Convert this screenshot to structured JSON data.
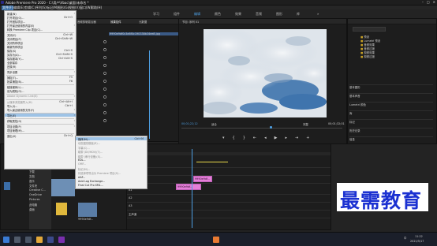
{
  "window": {
    "title": "Adobe Premiere Pro 2020 - C:\\用户\\Vbac\\桌面\\未命名 *",
    "minimize": "–",
    "maximize": "□",
    "close": "✕"
  },
  "menubar": [
    "文件(F)",
    "编辑(E)",
    "剪辑(C)",
    "序列(S)",
    "标记(M)",
    "图形(G)",
    "视图(V)",
    "窗口(W)",
    "帮助(H)"
  ],
  "workspace_tabs": [
    "学习",
    "组件",
    "编辑",
    "颜色",
    "效果",
    "音频",
    "图形",
    "库",
    "»"
  ],
  "file_menu": {
    "items": [
      {
        "label": "新建(N)",
        "shortcut": "",
        "arrow": true,
        "disabled": false
      },
      {
        "label": "打开项目(O)...",
        "shortcut": "Ctrl+O",
        "arrow": false,
        "disabled": false
      },
      {
        "label": "打开团队项目...",
        "shortcut": "",
        "arrow": false,
        "disabled": false
      },
      {
        "label": "打开最近使用的内容(E)",
        "shortcut": "",
        "arrow": true,
        "disabled": false
      },
      {
        "label": "转换 Premiere Clip 项目(C)...",
        "shortcut": "",
        "arrow": false,
        "disabled": false
      },
      {
        "sep": true
      },
      {
        "label": "关闭(C)",
        "shortcut": "Ctrl+W",
        "arrow": false,
        "disabled": false
      },
      {
        "label": "关闭项目(P)",
        "shortcut": "Ctrl+Shift+W",
        "arrow": false,
        "disabled": false
      },
      {
        "label": "关闭所有项目",
        "shortcut": "",
        "arrow": false,
        "disabled": false
      },
      {
        "label": "刷新所有项目",
        "shortcut": "",
        "arrow": false,
        "disabled": false
      },
      {
        "label": "保存(S)",
        "shortcut": "Ctrl+S",
        "arrow": false,
        "disabled": false
      },
      {
        "label": "另存为(A)...",
        "shortcut": "Ctrl+Shift+S",
        "arrow": false,
        "disabled": false
      },
      {
        "label": "保存副本(Y)...",
        "shortcut": "Ctrl+Alt+S",
        "arrow": false,
        "disabled": false
      },
      {
        "label": "全部保存",
        "shortcut": "",
        "arrow": false,
        "disabled": false
      },
      {
        "label": "还原(R)",
        "shortcut": "",
        "arrow": false,
        "disabled": false
      },
      {
        "sep": true
      },
      {
        "label": "同步设置",
        "shortcut": "",
        "arrow": true,
        "disabled": false
      },
      {
        "sep": true
      },
      {
        "label": "捕捉(T)...",
        "shortcut": "F5",
        "arrow": false,
        "disabled": false
      },
      {
        "label": "批量捕捉(B)...",
        "shortcut": "F6",
        "arrow": false,
        "disabled": false
      },
      {
        "sep": true
      },
      {
        "label": "链接媒体(L)...",
        "shortcut": "",
        "arrow": false,
        "disabled": false
      },
      {
        "label": "设为脱机(O)...",
        "shortcut": "",
        "arrow": false,
        "disabled": false
      },
      {
        "sep": true
      },
      {
        "label": "Adobe Dynamic Link(K)",
        "shortcut": "",
        "arrow": true,
        "disabled": true
      },
      {
        "sep": true
      },
      {
        "label": "从媒体浏览器导入(M)",
        "shortcut": "Ctrl+Alt+I",
        "arrow": false,
        "disabled": true
      },
      {
        "label": "导入(I)...",
        "shortcut": "Ctrl+I",
        "arrow": false,
        "disabled": false
      },
      {
        "label": "导入最近使用的文件(F)",
        "shortcut": "",
        "arrow": true,
        "disabled": false
      },
      {
        "sep": true
      },
      {
        "label": "导出(E)",
        "shortcut": "",
        "arrow": true,
        "disabled": false,
        "highlight": true
      },
      {
        "sep": true
      },
      {
        "label": "获取属性(G)",
        "shortcut": "",
        "arrow": true,
        "disabled": false
      },
      {
        "sep": true
      },
      {
        "label": "项目设置(P)",
        "shortcut": "",
        "arrow": true,
        "disabled": false
      },
      {
        "label": "项目管理(M)...",
        "shortcut": "",
        "arrow": false,
        "disabled": false
      },
      {
        "sep": true
      },
      {
        "label": "退出(X)",
        "shortcut": "Ctrl+Q",
        "arrow": false,
        "disabled": false
      }
    ]
  },
  "export_submenu": {
    "items": [
      {
        "label": "媒体(M)...",
        "shortcut": "Ctrl+M",
        "disabled": false,
        "highlight": true
      },
      {
        "label": "动态图形模板(R)...",
        "shortcut": "",
        "disabled": true
      },
      {
        "label": "字幕(C)...",
        "shortcut": "",
        "disabled": true
      },
      {
        "label": "磁带 (DV/HDV)(T)...",
        "shortcut": "",
        "disabled": true
      },
      {
        "label": "磁带 (串行设备)(S)...",
        "shortcut": "",
        "disabled": true
      },
      {
        "label": "EDL...",
        "shortcut": "",
        "disabled": false
      },
      {
        "label": "OMF...",
        "shortcut": "",
        "disabled": true
      },
      {
        "label": "标记(M)...",
        "shortcut": "",
        "disabled": true
      },
      {
        "label": "将选择项导出为 Premiere 项目(S)...",
        "shortcut": "",
        "disabled": true
      },
      {
        "label": "AAF...",
        "shortcut": "",
        "disabled": false
      },
      {
        "label": "Avid Log Exchange...",
        "shortcut": "",
        "disabled": false
      },
      {
        "label": "Final Cut Pro XML...",
        "shortcut": "",
        "disabled": false
      }
    ]
  },
  "source_panel": {
    "tab_effects": "效果控件",
    "tab_audio": "音频剪辑混合器",
    "tab_meta": "元数据"
  },
  "clip_name": "9990e9df0c3e8f0c190338b34ee8.jpg",
  "program_monitor": {
    "title": "节目: 序列 01",
    "timecode_left": "00;01;22;12",
    "fit": "适合",
    "quality": "完整",
    "timecode_right": "00;01;32;01"
  },
  "right_panel": {
    "folders": [
      "预设",
      "Lumetri 预设",
      "音频效果",
      "音频过渡",
      "视频效果",
      "视频过渡"
    ],
    "sections": [
      "基本图形",
      "基本声音",
      "Lumetri 颜色",
      "库",
      "标记",
      "历史记录",
      "信息"
    ]
  },
  "timeline": {
    "tracks": [
      "V3",
      "V2",
      "V1",
      "A1",
      "A2",
      "A3",
      "主声道"
    ],
    "clip_label": "9990e9df..."
  },
  "project_panel": {
    "items": [
      "照片",
      "Tencent",
      "下载",
      "文档",
      "音乐",
      "文件夹",
      "Creative C...",
      "OneDrive",
      "Pictures",
      "此电脑",
      "桌面"
    ],
    "thumb_label": "9990e9df..."
  },
  "taskbar": {
    "time": "11:22",
    "date": "2021/5/17",
    "lang": "中"
  },
  "watermark": "最需教育",
  "colors": {
    "accent": "#4d9de0",
    "clip_pink": "#e47fd8",
    "menu_highlight": "#9ec3e6",
    "watermark": "#1b31d1"
  }
}
